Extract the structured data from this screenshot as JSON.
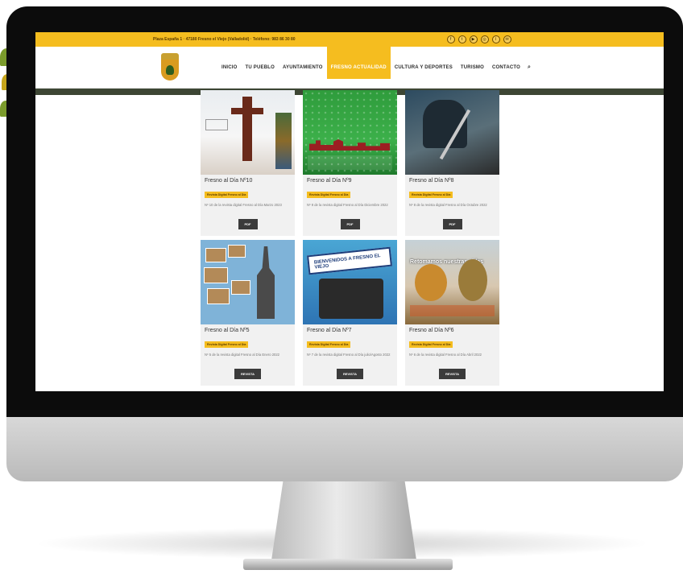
{
  "topbar": {
    "address": "Plaza España 1 · 47180 Fresno el Viejo (Valladolid) · Teléfono: 983 86 30 80",
    "social_icons": [
      "facebook-icon",
      "twitter-icon",
      "youtube-icon",
      "instagram-icon",
      "rss-icon",
      "email-icon"
    ]
  },
  "nav": {
    "items": [
      {
        "label": "INICIO",
        "active": false
      },
      {
        "label": "TU PUEBLO",
        "active": false
      },
      {
        "label": "AYUNTAMIENTO",
        "active": false
      },
      {
        "label": "FRESNO ACTUALIDAD",
        "active": true
      },
      {
        "label": "CULTURA Y DEPORTES",
        "active": false
      },
      {
        "label": "TURISMO",
        "active": false
      },
      {
        "label": "CONTACTO",
        "active": false
      }
    ]
  },
  "cards": [
    {
      "title": "Fresno al Día Nº10",
      "tag": "Revista Digital Fresno al Día",
      "desc": "Nº 10 de la revista digital Fresno al Día Marzo 2023",
      "button": "PDF"
    },
    {
      "title": "Fresno al Día Nº9",
      "tag": "Revista Digital Fresno al Día",
      "desc": "Nº 9 de la revista digital Fresno al Día Diciembre 2022",
      "button": "PDF"
    },
    {
      "title": "Fresno al Día Nº8",
      "tag": "Revista Digital Fresno al Día",
      "desc": "Nº 8 de la revista digital Fresno al Día Octubre 2022",
      "button": "PDF"
    },
    {
      "title": "Fresno al Día Nº5",
      "tag": "Revista Digital Fresno al Día",
      "desc": "Nº 5 de la revista digital Fresno al Día Enero 2022",
      "button": "REVISTA"
    },
    {
      "title": "Fresno al Día Nº7",
      "tag": "Revista Digital Fresno al Día",
      "desc": "Nº 7 de la revista digital Fresno al Día julio/Agosto 2022",
      "button": "REVISTA"
    },
    {
      "title": "Fresno al Día Nº6",
      "tag": "Revista Digital Fresno al Día",
      "desc": "Nº 6 de la revista digital Fresno al Día Abril 2022",
      "button": "REVISTA"
    }
  ],
  "cover_text": {
    "c5_headline": "BIENVENIDOS A FRESNO EL VIEJO",
    "c6_headline": "Retomamos nuestras vidas"
  },
  "colors": {
    "accent": "#f5bd1f",
    "band": "#3d4634",
    "button": "#3b3b3b"
  }
}
